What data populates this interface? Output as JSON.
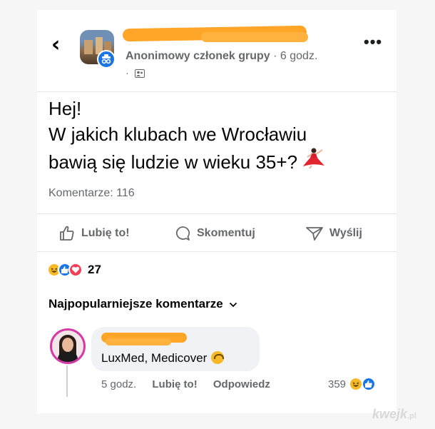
{
  "header": {
    "back_glyph": "‹",
    "author_meta_strong": "Anonimowy członek grupy",
    "author_meta_time": " · 6 godz.",
    "privacy_dot": "·",
    "more_glyph": "•••"
  },
  "post": {
    "line1": "Hej!",
    "line2": "W jakich klubach we Wrocławiu",
    "line3": "bawią się ludzie w wieku 35+?",
    "comments_count": "Komentarze: 116"
  },
  "actions": {
    "like": "Lubię to!",
    "comment": "Skomentuj",
    "share": "Wyślij"
  },
  "reactions": {
    "count": "27"
  },
  "comments_section": {
    "sort_label": "Najpopularniejsze komentarze",
    "sort_chevron": "⌄"
  },
  "comment": {
    "text": "LuxMed, Medicover",
    "time": "5 godz.",
    "like": "Lubię to!",
    "reply": "Odpowiedz",
    "reaction_count": "359"
  },
  "watermark": {
    "main": "kwejk",
    "suffix": ".pl"
  },
  "colors": {
    "redaction": "#ffa629",
    "accent_blue": "#1b74e4",
    "secondary_text": "#65676b"
  }
}
